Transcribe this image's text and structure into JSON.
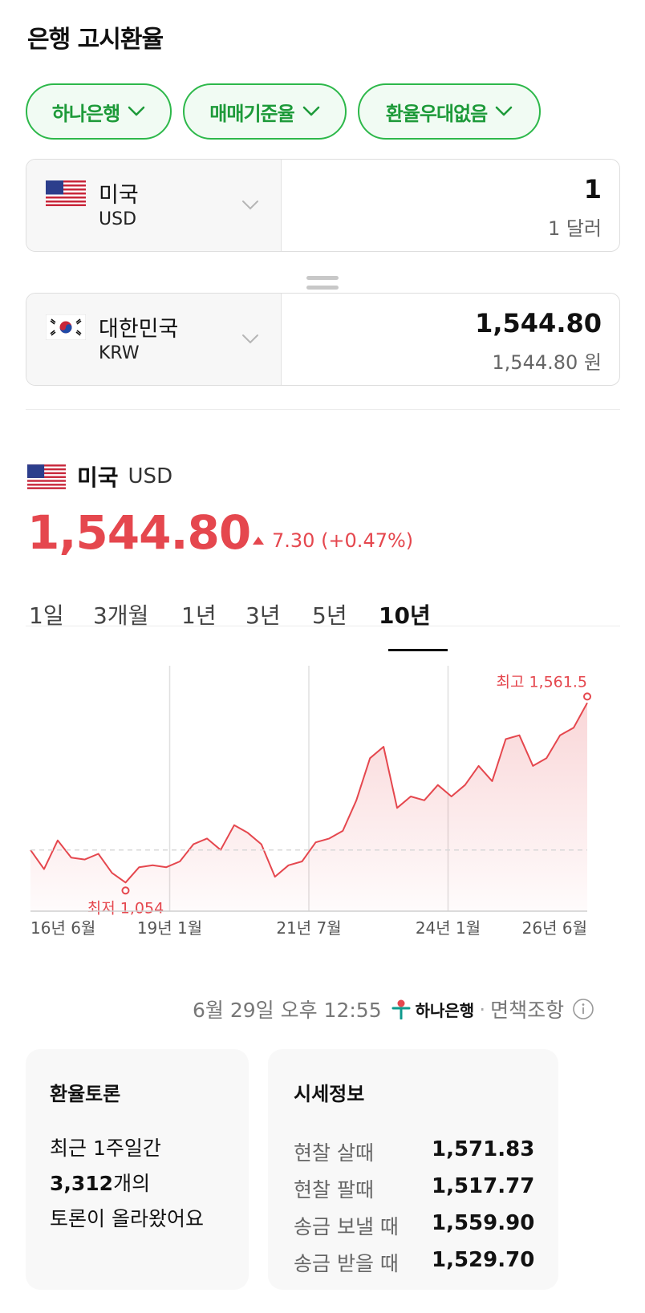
{
  "page_title": "은행 고시환율",
  "filters": [
    {
      "label": "하나은행"
    },
    {
      "label": "매매기준율"
    },
    {
      "label": "환율우대없음"
    }
  ],
  "from": {
    "country": "미국",
    "code": "USD",
    "amount": "1",
    "amount_text": "1 달러"
  },
  "to": {
    "country": "대한민국",
    "code": "KRW",
    "amount": "1,544.80",
    "amount_text": "1,544.80 원"
  },
  "summary": {
    "country": "미국",
    "code": "USD",
    "price": "1,544.80",
    "change": "7.30 (+0.47%)"
  },
  "tabs": [
    "1일",
    "3개월",
    "1년",
    "3년",
    "5년",
    "10년"
  ],
  "active_tab": "10년",
  "chart_data": {
    "type": "area",
    "x_tick_labels": [
      "16년 6월",
      "19년 1월",
      "21년 7월",
      "24년 1월",
      "26년 6월"
    ],
    "x": [
      "16-06",
      "16-09",
      "16-12",
      "17-03",
      "17-06",
      "17-09",
      "17-12",
      "18-03",
      "18-06",
      "18-09",
      "18-12",
      "19-03",
      "19-06",
      "19-09",
      "19-12",
      "20-03",
      "20-06",
      "20-09",
      "20-12",
      "21-03",
      "21-06",
      "21-09",
      "21-12",
      "22-03",
      "22-06",
      "22-09",
      "22-10",
      "22-12",
      "23-03",
      "23-06",
      "23-09",
      "23-12",
      "24-03",
      "24-06",
      "24-09",
      "24-12",
      "25-03",
      "25-06",
      "25-09",
      "25-12",
      "26-03",
      "26-06"
    ],
    "y": [
      1160,
      1110,
      1185,
      1140,
      1135,
      1150,
      1100,
      1075,
      1115,
      1120,
      1115,
      1130,
      1175,
      1190,
      1160,
      1225,
      1205,
      1175,
      1090,
      1120,
      1130,
      1180,
      1190,
      1210,
      1290,
      1400,
      1430,
      1270,
      1300,
      1290,
      1330,
      1300,
      1330,
      1380,
      1340,
      1450,
      1460,
      1380,
      1400,
      1460,
      1480,
      1544.8
    ],
    "max_label": "최고 1,561.5",
    "min_label": "최저 1,054",
    "max": 1561.5,
    "min": 1054,
    "ylim": [
      1000,
      1600
    ],
    "grid": "vertical",
    "color": "#e5474e"
  },
  "meta": {
    "timestamp": "6월 29일 오후 12:55",
    "bank": "하나은행",
    "disclaimer": "면책조항"
  },
  "discussion": {
    "title": "환율토론",
    "line1": "최근 1주일간",
    "count": "3,312",
    "count_suffix": "개의",
    "line3": "토론이 올라왔어요"
  },
  "rates": {
    "title": "시세정보",
    "rows": [
      {
        "label": "현찰 살때",
        "value": "1,571.83"
      },
      {
        "label": "현찰 팔때",
        "value": "1,517.77"
      },
      {
        "label": "송금 보낼 때",
        "value": "1,559.90"
      },
      {
        "label": "송금 받을 때",
        "value": "1,529.70"
      }
    ]
  },
  "colors": {
    "accent_green": "#2db84a",
    "price_red": "#e5474e"
  }
}
